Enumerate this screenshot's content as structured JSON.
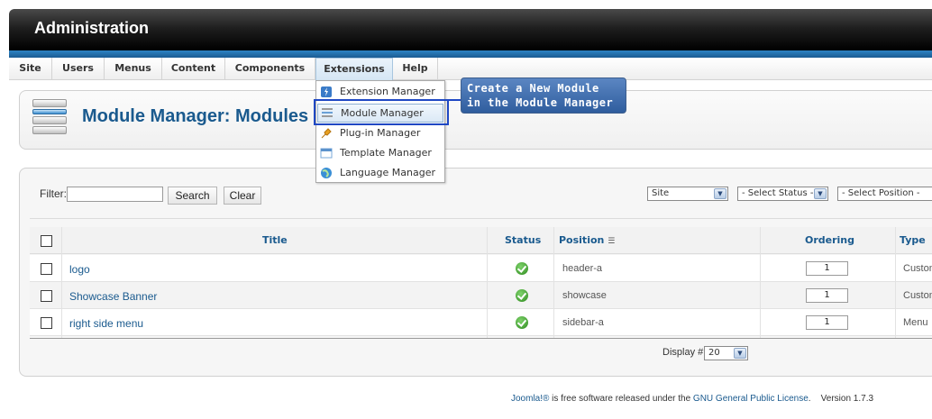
{
  "header": {
    "title": "Administration"
  },
  "menubar": {
    "items": [
      {
        "label": "Site"
      },
      {
        "label": "Users"
      },
      {
        "label": "Menus"
      },
      {
        "label": "Content"
      },
      {
        "label": "Components"
      },
      {
        "label": "Extensions",
        "active": true
      },
      {
        "label": "Help"
      }
    ]
  },
  "extensions_menu": {
    "items": [
      {
        "label": "Extension Manager",
        "icon": "extension-icon"
      },
      {
        "label": "Module Manager",
        "icon": "module-icon",
        "highlighted": true
      },
      {
        "label": "Plug-in Manager",
        "icon": "plugin-icon"
      },
      {
        "label": "Template Manager",
        "icon": "template-icon"
      },
      {
        "label": "Language Manager",
        "icon": "language-icon"
      }
    ]
  },
  "callout": {
    "line1": "Create a New Module",
    "line2": "in the Module Manager"
  },
  "toolbar": {
    "page_title": "Module Manager: Modules"
  },
  "filter": {
    "label": "Filter:",
    "value": "",
    "search_label": "Search",
    "clear_label": "Clear",
    "client_select": "Site",
    "status_select": "- Select Status -",
    "position_select": "- Select Position -"
  },
  "table": {
    "headers": {
      "title": "Title",
      "status": "Status",
      "position": "Position",
      "ordering": "Ordering",
      "type": "Type"
    },
    "rows": [
      {
        "title": "logo",
        "status": "published",
        "position": "header-a",
        "ordering": "1",
        "type": "Custom"
      },
      {
        "title": "Showcase Banner",
        "status": "published",
        "position": "showcase",
        "ordering": "1",
        "type": "Custom"
      },
      {
        "title": "right side menu",
        "status": "published",
        "position": "sidebar-a",
        "ordering": "1",
        "type": "Menu"
      }
    ]
  },
  "pagination": {
    "display_label": "Display #",
    "display_value": "20"
  },
  "footer": {
    "joomla_link": "Joomla!®",
    "text": " is free software released under the ",
    "license_link": "GNU General Public License",
    "version": "Version 1.7.3"
  },
  "colors": {
    "accent": "#1a5a8e",
    "header": "#000000",
    "blue_bar": "#2d84c4",
    "highlight": "#1f48c4"
  }
}
